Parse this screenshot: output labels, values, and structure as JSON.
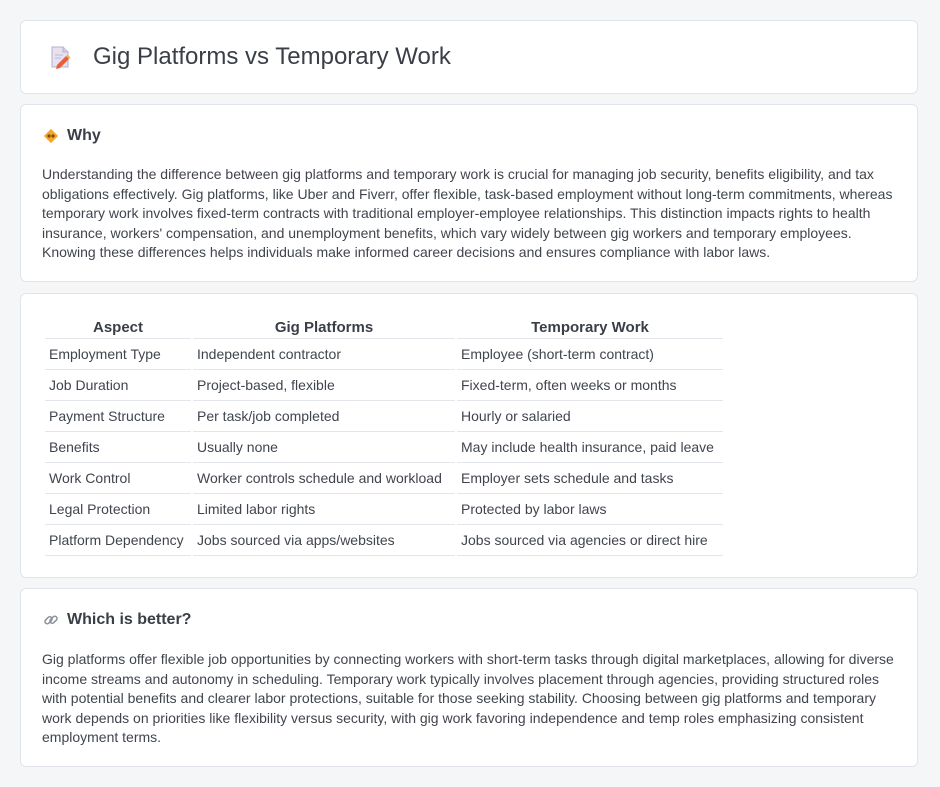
{
  "page": {
    "title": "Gig Platforms vs Temporary Work",
    "title_icon": "document-pencil-icon"
  },
  "why": {
    "heading": "Why",
    "icon": "diamond-sign-icon",
    "text": "Understanding the difference between gig platforms and temporary work is crucial for managing job security, benefits eligibility, and tax obligations effectively. Gig platforms, like Uber and Fiverr, offer flexible, task-based employment without long-term commitments, whereas temporary work involves fixed-term contracts with traditional employer-employee relationships. This distinction impacts rights to health insurance, workers' compensation, and unemployment benefits, which vary widely between gig workers and temporary employees. Knowing these differences helps individuals make informed career decisions and ensures compliance with labor laws."
  },
  "comparison": {
    "headers": [
      "Aspect",
      "Gig Platforms",
      "Temporary Work"
    ],
    "rows": [
      [
        "Employment Type",
        "Independent contractor",
        "Employee (short-term contract)"
      ],
      [
        "Job Duration",
        "Project-based, flexible",
        "Fixed-term, often weeks or months"
      ],
      [
        "Payment Structure",
        "Per task/job completed",
        "Hourly or salaried"
      ],
      [
        "Benefits",
        "Usually none",
        "May include health insurance, paid leave"
      ],
      [
        "Work Control",
        "Worker controls schedule and workload",
        "Employer sets schedule and tasks"
      ],
      [
        "Legal Protection",
        "Limited labor rights",
        "Protected by labor laws"
      ],
      [
        "Platform Dependency",
        "Jobs sourced via apps/websites",
        "Jobs sourced via agencies or direct hire"
      ]
    ]
  },
  "better": {
    "heading": "Which is better?",
    "icon": "link-icon",
    "text": "Gig platforms offer flexible job opportunities by connecting workers with short-term tasks through digital marketplaces, allowing for diverse income streams and autonomy in scheduling. Temporary work typically involves placement through agencies, providing structured roles with potential benefits and clearer labor protections, suitable for those seeking stability. Choosing between gig platforms and temporary work depends on priorities like flexibility versus security, with gig work favoring independence and temp roles emphasizing consistent employment terms."
  }
}
